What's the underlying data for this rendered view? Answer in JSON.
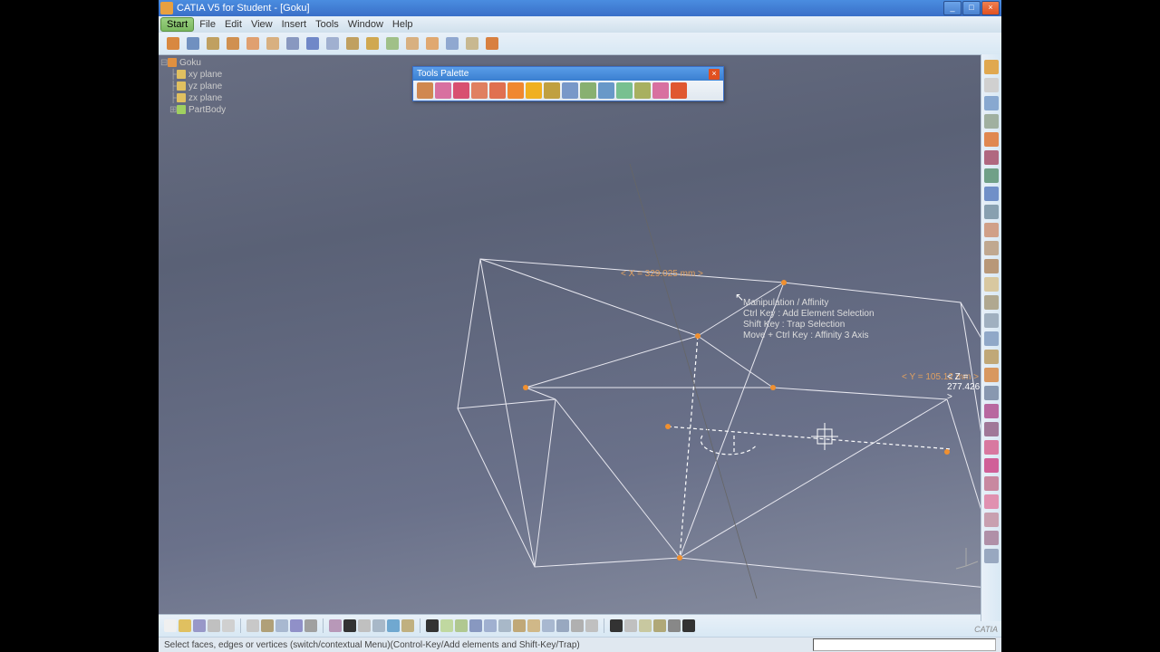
{
  "window": {
    "title": "CATIA V5 for Student - [Goku]"
  },
  "menu": {
    "start": "Start",
    "items": [
      "File",
      "Edit",
      "View",
      "Insert",
      "Tools",
      "Window",
      "Help"
    ]
  },
  "tree": {
    "root": "Goku",
    "items": [
      "xy plane",
      "yz plane",
      "zx plane",
      "PartBody"
    ]
  },
  "palette": {
    "title": "Tools Palette"
  },
  "hint": {
    "l1": "Manipulation / Affinity",
    "l2": "Ctrl Key : Add Element Selection",
    "l3": "Shift Key : Trap Selection",
    "l4": "Move + Ctrl Key : Affinity 3 Axis"
  },
  "dims": {
    "x": "< X = 329.025 mm >",
    "y": "< Y = 105.12 mm >",
    "z": "< Z = 277.426 mm >"
  },
  "status": {
    "msg": "Select faces, edges or vertices (switch/contextual Menu)(Control-Key/Add elements and Shift-Key/Trap)"
  },
  "toolbar_colors": [
    "#d88840",
    "#7090c0",
    "#c0a060",
    "#d09050",
    "#e0a070",
    "#d8b080",
    "#8898c0",
    "#7088c8",
    "#a0b0d0",
    "#c0a060",
    "#d0a850",
    "#a0c088",
    "#d8b080",
    "#e0a870",
    "#90a8d0",
    "#c8b890",
    "#d88040"
  ],
  "palette_colors": [
    "#d08850",
    "#d870a0",
    "#d85070",
    "#e08060",
    "#e07050",
    "#f08830",
    "#f0b020",
    "#c0a040",
    "#7898c8",
    "#88b070",
    "#6898c8",
    "#78c090",
    "#a8b060",
    "#d870a0",
    "#e05830"
  ],
  "rside_colors": [
    "#e0a850",
    "#d0d0d0",
    "#88a8d0",
    "#a0b0a0",
    "#e08850",
    "#b06880",
    "#70a088",
    "#7090c8",
    "#88a0b0",
    "#d0a088",
    "#c0a890",
    "#b89878",
    "#d8c8a0",
    "#b0a890",
    "#a0b0c0",
    "#90a8c8",
    "#c0a878",
    "#d89860",
    "#8898b0",
    "#b868a0",
    "#a07898",
    "#d878a0",
    "#d06098",
    "#c888a0",
    "#e090b0",
    "#c8a0b0",
    "#b090a8",
    "#98a8c0"
  ],
  "bbar_colors": [
    "#f0f0f0",
    "#e0c060",
    "#9898c8",
    "#c0c0c0",
    "#d0d0d0",
    "#c8c8c8",
    "#b0a078",
    "#a8b8d0",
    "#9090c8",
    "#a0a0a0",
    "#b898b8",
    "#333",
    "#c0c0c0",
    "#a8b8c8",
    "#70a8d0",
    "#c0b080",
    "#333",
    "#c0d8a0",
    "#b0c890",
    "#8898c0",
    "#a0b0d0",
    "#a8b8c8",
    "#c0a878",
    "#d0b888",
    "#a8b8d0",
    "#98a8c0",
    "#b0b0b0",
    "#c0c0c0",
    "#333",
    "#c0c0c0",
    "#c8c8a0",
    "#b0a878",
    "#888",
    "#333"
  ],
  "logo": "CATIA"
}
